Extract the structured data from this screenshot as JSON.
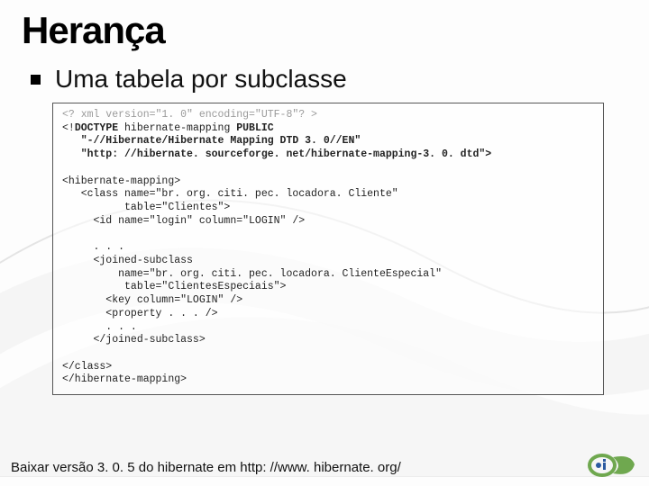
{
  "title": "Herança",
  "subtitle": "Uma tabela por subclasse",
  "code": {
    "l1": "<? xml version=\"1. 0\" encoding=\"UTF-8\"? >",
    "l2a": "<!",
    "l2b": "DOCTYPE",
    "l2c": " hibernate-mapping ",
    "l2d": "PUBLIC",
    "l3": "   \"-//Hibernate/Hibernate Mapping DTD 3. 0//EN\"",
    "l4": "   \"http: //hibernate. sourceforge. net/hibernate-mapping-3. 0. dtd\">",
    "l5": "",
    "l6": "<hibernate-mapping>",
    "l7": "   <class name=\"br. org. citi. pec. locadora. Cliente\"",
    "l8": "          table=\"Clientes\">",
    "l9": "     <id name=\"login\" column=\"LOGIN\" />",
    "l10": "",
    "l11": "     . . .",
    "l12": "     <joined-subclass",
    "l13": "         name=\"br. org. citi. pec. locadora. ClienteEspecial\"",
    "l14": "          table=\"ClientesEspeciais\">",
    "l15": "       <key column=\"LOGIN\" />",
    "l16": "       <property . . . />",
    "l17": "       . . .",
    "l18": "     </joined-subclass>",
    "l19": "",
    "l20": "</class>",
    "l21": "</hibernate-mapping>"
  },
  "footer": "Baixar versão 3. 0. 5 do hibernate em http: //www. hibernate. org/"
}
